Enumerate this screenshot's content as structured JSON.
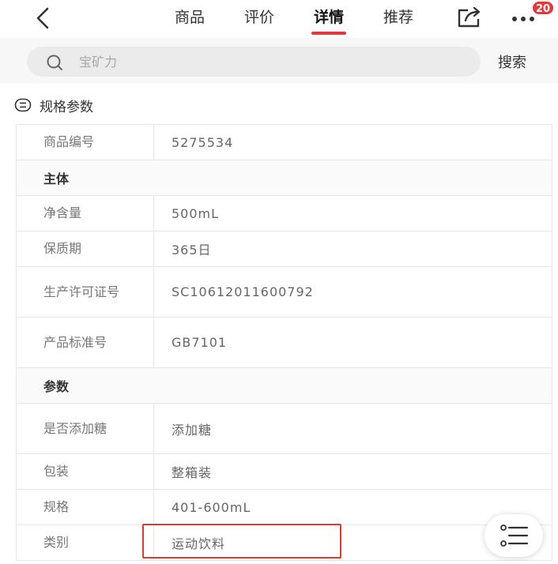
{
  "header": {
    "tabs": [
      {
        "label": "商品",
        "active": false
      },
      {
        "label": "评价",
        "active": false
      },
      {
        "label": "详情",
        "active": true
      },
      {
        "label": "推荐",
        "active": false
      }
    ],
    "badge_count": "20",
    "icons": [
      "back-arrow-icon",
      "share-icon",
      "more-icon"
    ],
    "accent_color": "#e4393c"
  },
  "search": {
    "placeholder": "宝矿力",
    "button_label": "搜索"
  },
  "section": {
    "title": "规格参数"
  },
  "specs": {
    "product_no": {
      "key": "商品编号",
      "value": "5275534"
    },
    "group_main": "主体",
    "net_volume": {
      "key": "净含量",
      "value": "500mL"
    },
    "shelf_life": {
      "key": "保质期",
      "value": "365日"
    },
    "license": {
      "key": "生产许可证号",
      "value": "SC10612011600792"
    },
    "standard": {
      "key": "产品标准号",
      "value": "GB7101"
    },
    "group_params": "参数",
    "added_sugar": {
      "key": "是否添加糖",
      "value": "添加糖"
    },
    "packaging": {
      "key": "包装",
      "value": "整箱装"
    },
    "size": {
      "key": "规格",
      "value": "401-600mL"
    },
    "category": {
      "key": "类别",
      "value": "运动饮料"
    }
  }
}
